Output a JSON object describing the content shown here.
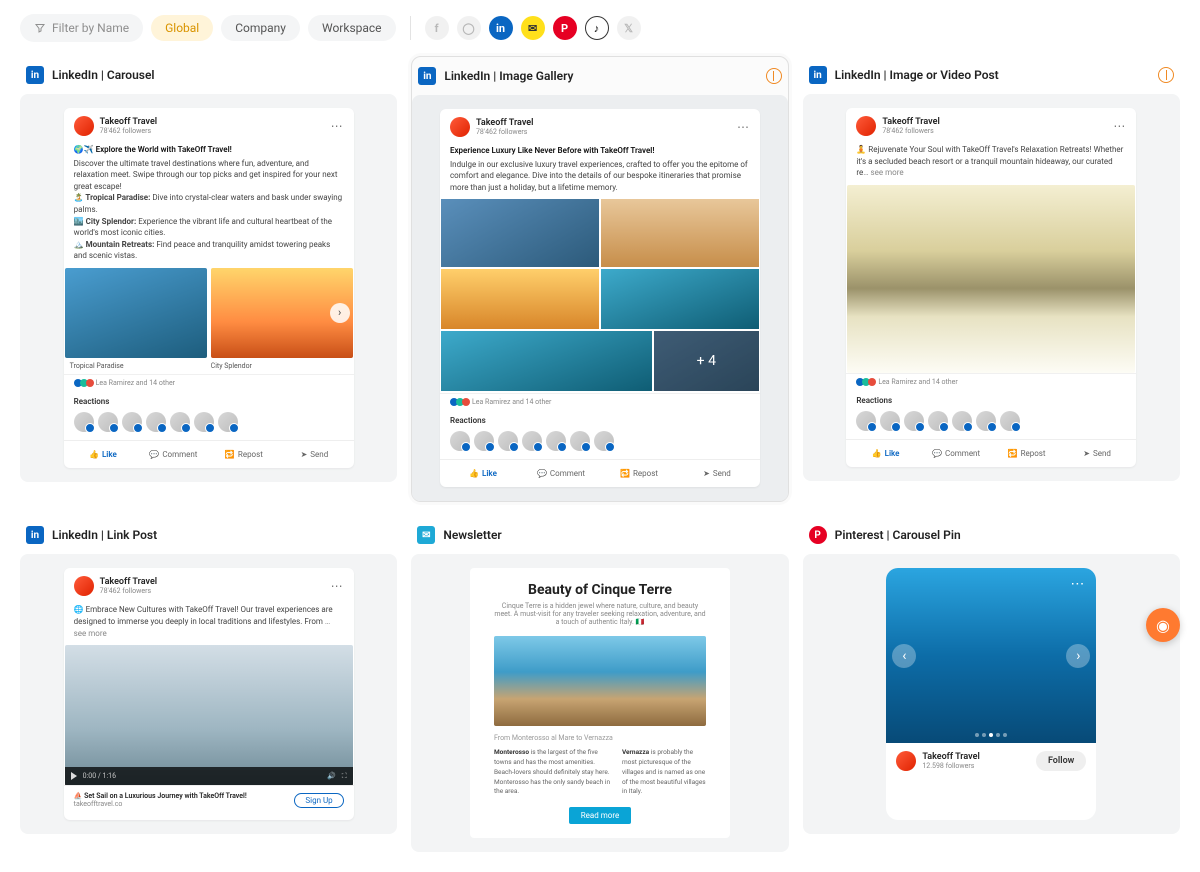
{
  "filter": {
    "placeholder": "Filter by Name"
  },
  "scopes": [
    {
      "label": "Global",
      "active": true
    },
    {
      "label": "Company",
      "active": false
    },
    {
      "label": "Workspace",
      "active": false
    }
  ],
  "social_icons": [
    "facebook",
    "instagram",
    "linkedin",
    "mailchimp",
    "pinterest",
    "tiktok",
    "x"
  ],
  "author": {
    "name": "Takeoff Travel",
    "followers": "78'462 followers"
  },
  "reactions_text": "Lea Ramirez and 14 other",
  "reactions_label": "Reactions",
  "actions": {
    "like": "Like",
    "comment": "Comment",
    "repost": "Repost",
    "send": "Send"
  },
  "cards": {
    "carousel": {
      "title": "LinkedIn | Carousel",
      "platform": "linkedin",
      "post_title": "🌍✈️ Explore the World with TakeOff Travel!",
      "post_body": "Discover the ultimate travel destinations where fun, adventure, and relaxation meet. Swipe through our top picks and get inspired for your next great escape!",
      "point1_label": "🏝️ Tropical Paradise:",
      "point1_text": " Dive into crystal-clear waters and bask under swaying palms.",
      "point2_label": "🏙️ City Splendor:",
      "point2_text": " Experience the vibrant life and cultural heartbeat of the world's most iconic cities.",
      "point3_label": "🏔️ Mountain Retreats:",
      "point3_text": " Find peace and tranquility amidst towering peaks and scenic vistas.",
      "cap1": "Tropical Paradise",
      "cap2": "City Splendor"
    },
    "gallery": {
      "title": "LinkedIn | Image Gallery",
      "platform": "linkedin",
      "selected": true,
      "globe": true,
      "post_title": "Experience Luxury Like Never Before with TakeOff Travel!",
      "post_body": "Indulge in our exclusive luxury travel experiences, crafted to offer you the epitome of comfort and elegance. Dive into the details of our bespoke itineraries that promise more than just a holiday, but a lifetime memory.",
      "more": "+ 4"
    },
    "imageorvideo": {
      "title": "LinkedIn | Image or Video Post",
      "platform": "linkedin",
      "globe": true,
      "post_body_prefix": "🧘 Rejuvenate Your Soul with TakeOff Travel's Relaxation Retreats! Whether it's a secluded beach resort or a tranquil mountain hideaway, our curated re",
      "see_more": "… see more"
    },
    "linkpost": {
      "title": "LinkedIn | Link Post",
      "platform": "linkedin",
      "post_body_prefix": "🌐 Embrace New Cultures with TakeOff Travel! Our travel experiences are designed to immerse you deeply in local traditions and lifestyles. From ",
      "see_more": "… see more",
      "video_time": "0:00 / 1:16",
      "cta_title": "⛵ Set Sail on a Luxurious Journey with TakeOff Travel!",
      "cta_url": "takeofftravel.co",
      "signup": "Sign Up"
    },
    "newsletter": {
      "title": "Newsletter",
      "platform": "mailchimp",
      "h": "Beauty of Cinque Terre",
      "sub": "Cinque Terre is a hidden jewel where nature, culture, and beauty meet. A must-visit for any traveler seeking relaxation, adventure, and a touch of authentic Italy. 🇮🇹",
      "caption": "From Monterosso al Mare to Vernazza",
      "col1_strong": "Monterosso",
      "col1_text": " is the largest of the five towns and has the most amenities. Beach-lovers should definitely stay here. Monterosso has the only sandy beach in the area.",
      "col2_strong": "Vernazza",
      "col2_text": " is probably the most picturesque of the villages and is named as one of the most beautiful villages in Italy.",
      "readmore": "Read more"
    },
    "pinterest": {
      "title": "Pinterest | Carousel Pin",
      "platform": "pinterest",
      "author": "Takeoff Travel",
      "followers": "12.598 followers",
      "follow": "Follow"
    }
  }
}
